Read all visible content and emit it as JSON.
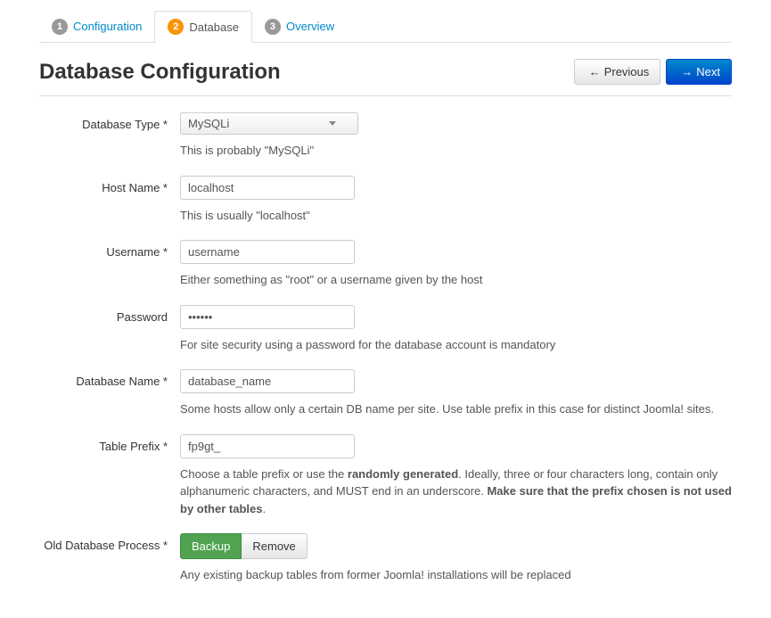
{
  "steps": {
    "s1": {
      "num": "1",
      "label": "Configuration"
    },
    "s2": {
      "num": "2",
      "label": "Database"
    },
    "s3": {
      "num": "3",
      "label": "Overview"
    }
  },
  "page_title": "Database Configuration",
  "nav": {
    "previous": "Previous",
    "next": "Next"
  },
  "fields": {
    "dbtype": {
      "label": "Database Type *",
      "value": "MySQLi",
      "help": "This is probably \"MySQLi\""
    },
    "hostname": {
      "label": "Host Name *",
      "value": "localhost",
      "help": "This is usually \"localhost\""
    },
    "username": {
      "label": "Username *",
      "value": "username",
      "help": "Either something as \"root\" or a username given by the host"
    },
    "password": {
      "label": "Password",
      "value": "••••••",
      "help": "For site security using a password for the database account is mandatory"
    },
    "dbname": {
      "label": "Database Name *",
      "value": "database_name",
      "help": "Some hosts allow only a certain DB name per site. Use table prefix in this case for distinct Joomla! sites."
    },
    "prefix": {
      "label": "Table Prefix *",
      "value": "fp9gt_",
      "help_p1": "Choose a table prefix or use the ",
      "help_b1": "randomly generated",
      "help_p2": ". Ideally, three or four characters long, contain only alphanumeric characters, and MUST end in an underscore. ",
      "help_b2": "Make sure that the prefix chosen is not used by other tables",
      "help_p3": "."
    },
    "olddb": {
      "label": "Old Database Process *",
      "backup": "Backup",
      "remove": "Remove",
      "help": "Any existing backup tables from former Joomla! installations will be replaced"
    }
  }
}
